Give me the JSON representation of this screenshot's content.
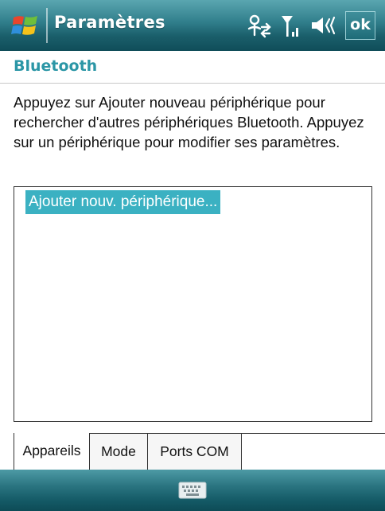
{
  "titlebar": {
    "title": "Paramètres",
    "ok_label": "ok",
    "icons": [
      "windows-start-icon",
      "bluetooth-connectivity-icon",
      "signal-strength-icon",
      "volume-icon"
    ]
  },
  "page": {
    "heading": "Bluetooth",
    "instructions": "Appuyez sur Ajouter nouveau périphérique pour rechercher d'autres périphériques Bluetooth. Appuyez sur un périphérique pour modifier ses paramètres."
  },
  "device_list": {
    "items": [
      {
        "label": "Ajouter nouv. périphérique...",
        "selected": true
      }
    ]
  },
  "tabs": [
    {
      "label": "Appareils",
      "active": true
    },
    {
      "label": "Mode",
      "active": false
    },
    {
      "label": "Ports COM",
      "active": false
    }
  ],
  "bottombar": {
    "icons": [
      "keyboard-icon"
    ]
  },
  "colors": {
    "titlebar": "#2f7d8a",
    "heading": "#2b96a6",
    "selection": "#3bb1c2"
  }
}
